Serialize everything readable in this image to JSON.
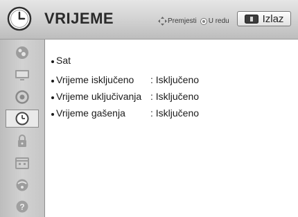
{
  "header": {
    "title": "VRIJEME",
    "hint_move": "Premjesti",
    "hint_ok": "U redu",
    "exit_label": "Izlaz"
  },
  "sidebar": {
    "items": [
      {
        "icon": "image-icon"
      },
      {
        "icon": "screen-icon"
      },
      {
        "icon": "speaker-icon"
      },
      {
        "icon": "clock-icon",
        "active": true
      },
      {
        "icon": "lock-icon"
      },
      {
        "icon": "calendar-icon"
      },
      {
        "icon": "network-icon"
      },
      {
        "icon": "help-icon"
      }
    ]
  },
  "menu": {
    "items": [
      {
        "label": "Sat",
        "value": ""
      },
      {
        "label": "Vrijeme isključeno",
        "value": ": Isključeno"
      },
      {
        "label": "Vrijeme uključivanja",
        "value": ": Isključeno"
      },
      {
        "label": "Vrijeme gašenja",
        "value": ": Isključeno"
      }
    ]
  }
}
